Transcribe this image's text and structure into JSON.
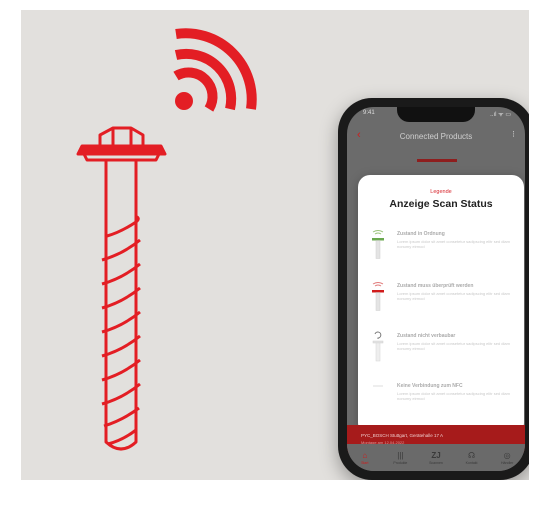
{
  "phone": {
    "status_time": "9:41",
    "status_right": "..ıl ᯤ ▭",
    "header_title": "Connected Products"
  },
  "modal": {
    "overline": "Legende",
    "title": "Anzeige Scan Status",
    "items": [
      {
        "label": "Zustand in Ordnung",
        "desc": "Lorem ipsum dolor sit amet consetetur sadipscing elitr sed diam nonumy eirmod",
        "icon": "anchor-ok-icon"
      },
      {
        "label": "Zustand muss überprüft werden",
        "desc": "Lorem ipsum dolor sit amet consetetur sadipscing elitr sed diam nonumy eirmod",
        "icon": "anchor-check-icon"
      },
      {
        "label": "Zustand nicht verbaubar",
        "desc": "Lorem ipsum dolor sit amet consetetur sadipscing elitr sed diam nonumy eirmod",
        "icon": "anchor-unknown-icon"
      },
      {
        "label": "Keine Verbindung zum NFC",
        "desc": "Lorem ipsum dolor sit amet consetetur sadipscing elitr sed diam nonumy eirmod",
        "icon": "nfc-none-icon"
      }
    ]
  },
  "bottom_card": {
    "title": "PYC_BOSCH Stuttgart, Gerätehalle 17 A",
    "subtitle": "Montage am 12.04.2022"
  },
  "nav": {
    "items": [
      {
        "label": "Start",
        "glyph": "⌂",
        "icon": "home-icon"
      },
      {
        "label": "Produkte",
        "glyph": "|||",
        "icon": "products-icon"
      },
      {
        "label": "Scannen",
        "glyph": "ZJ",
        "icon": "scan-icon"
      },
      {
        "label": "Kontakt",
        "glyph": "☊",
        "icon": "contact-icon"
      },
      {
        "label": "Händler",
        "glyph": "◎",
        "icon": "dealer-icon"
      }
    ]
  },
  "colors": {
    "brand_red": "#e31e24",
    "background": "#e2e0dd"
  }
}
